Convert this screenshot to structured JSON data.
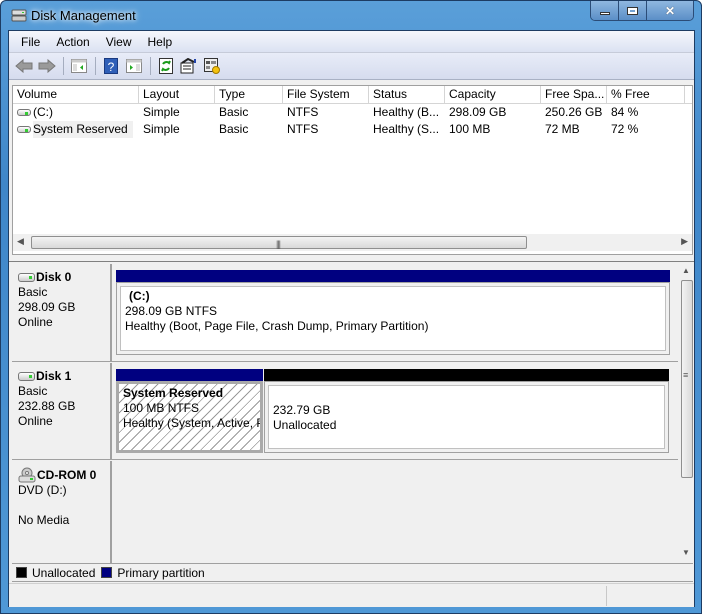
{
  "window": {
    "title": "Disk Management",
    "controls": {
      "minimize": "minimize",
      "maximize": "maximize",
      "close": "close"
    }
  },
  "menu": [
    {
      "label": "File"
    },
    {
      "label": "Action"
    },
    {
      "label": "View"
    },
    {
      "label": "Help"
    }
  ],
  "toolbar": {
    "buttons": [
      {
        "name": "back",
        "icon": "arrow-left-icon"
      },
      {
        "name": "forward",
        "icon": "arrow-right-icon"
      },
      {
        "name": "show-hide-console-tree",
        "icon": "console-tree-icon"
      },
      {
        "name": "help",
        "icon": "help-icon"
      },
      {
        "name": "show-hide-action-pane",
        "icon": "action-pane-icon"
      },
      {
        "name": "refresh",
        "icon": "refresh-icon"
      },
      {
        "name": "rescan-disks",
        "icon": "rescan-icon"
      },
      {
        "name": "properties",
        "icon": "properties-icon"
      }
    ]
  },
  "volume_list": {
    "columns": [
      "Volume",
      "Layout",
      "Type",
      "File System",
      "Status",
      "Capacity",
      "Free Spa...",
      "% Free"
    ],
    "rows": [
      {
        "volume": " (C:)",
        "layout": "Simple",
        "type": "Basic",
        "fs": "NTFS",
        "status": "Healthy (B...",
        "capacity": "298.09 GB",
        "free": "250.26 GB",
        "pct_free": "84 %"
      },
      {
        "volume": "System Reserved",
        "layout": "Simple",
        "type": "Basic",
        "fs": "NTFS",
        "status": "Healthy (S...",
        "capacity": "100 MB",
        "free": "72 MB",
        "pct_free": "72 %"
      }
    ],
    "hscroll_grip": "|||"
  },
  "disks": [
    {
      "name": "Disk 0",
      "type": "Basic",
      "size": "298.09 GB",
      "state": "Online",
      "partitions": [
        {
          "label": "(C:)",
          "size_fs": "298.09 GB NTFS",
          "status": "Healthy (Boot, Page File, Crash Dump, Primary Partition)",
          "kind": "primary"
        }
      ]
    },
    {
      "name": "Disk 1",
      "type": "Basic",
      "size": "232.88 GB",
      "state": "Online",
      "partitions": [
        {
          "label": "System Reserved",
          "size_fs": "100 MB NTFS",
          "status": "Healthy (System, Active, Primary Partition)",
          "kind": "primary",
          "selected": true
        },
        {
          "label": "",
          "size_fs": "232.79 GB",
          "status": "Unallocated",
          "kind": "unallocated"
        }
      ]
    },
    {
      "name": "CD-ROM 0",
      "type": "DVD (D:)",
      "size": "",
      "state": "No Media",
      "partitions": []
    }
  ],
  "legend": [
    {
      "label": "Unallocated",
      "color": "#000000"
    },
    {
      "label": "Primary partition",
      "color": "#000080"
    }
  ],
  "colors": {
    "primary": "#000080",
    "unallocated": "#000000"
  }
}
